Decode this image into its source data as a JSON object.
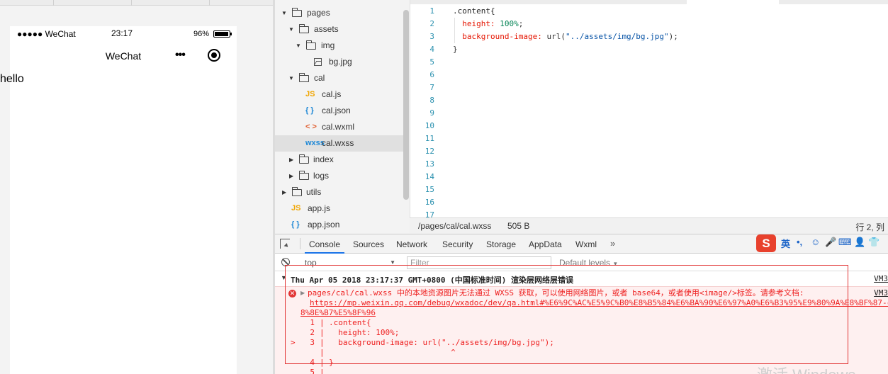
{
  "simulator": {
    "status_signal": "●●●●● WeChat",
    "status_time": "23:17",
    "status_battery": "96%",
    "nav_title": "WeChat",
    "nav_more": "•••",
    "content_text": "hello"
  },
  "tree": {
    "items": [
      {
        "label": "pages",
        "type": "folder",
        "expanded": true
      },
      {
        "label": "assets",
        "type": "folder",
        "expanded": true
      },
      {
        "label": "img",
        "type": "folder",
        "expanded": true
      },
      {
        "label": "bg.jpg",
        "type": "image"
      },
      {
        "label": "cal",
        "type": "folder",
        "expanded": true
      },
      {
        "label": "cal.js",
        "type": "js",
        "icon": "JS"
      },
      {
        "label": "cal.json",
        "type": "json",
        "icon": "{ }"
      },
      {
        "label": "cal.wxml",
        "type": "wxml",
        "icon": "< >"
      },
      {
        "label": "cal.wxss",
        "type": "wxss",
        "icon": "wxss",
        "selected": true
      },
      {
        "label": "index",
        "type": "folder",
        "expanded": false
      },
      {
        "label": "logs",
        "type": "folder",
        "expanded": false
      },
      {
        "label": "utils",
        "type": "folder",
        "expanded": false
      },
      {
        "label": "app.js",
        "type": "js",
        "icon": "JS"
      },
      {
        "label": "app.json",
        "type": "json",
        "icon": "{ }"
      }
    ]
  },
  "editor": {
    "line_numbers": [
      "1",
      "2",
      "3",
      "4",
      "5",
      "6",
      "7",
      "8",
      "9",
      "10",
      "11",
      "12",
      "13",
      "14",
      "15",
      "16",
      "17"
    ],
    "code": {
      "l1_selector": ".content{",
      "l2_prop": "height:",
      "l2_val": "100%",
      "l3_prop": "background-image:",
      "l3_fn": "url(",
      "l3_str": "\"../assets/img/bg.jpg\"",
      "l3_end": ");",
      "l4": "}"
    },
    "status_path": "/pages/cal/cal.wxss",
    "status_size": "505 B",
    "status_pos": "行 2, 列"
  },
  "devtools": {
    "tabs": [
      "Console",
      "Sources",
      "Network",
      "Security",
      "Storage",
      "AppData",
      "Wxml"
    ],
    "more": "»",
    "context": "top",
    "filter_placeholder": "Filter",
    "levels": "Default levels",
    "ime": {
      "logo": "S",
      "lang": "英",
      "punct": "•,",
      "emoji": "☺",
      "mic": "🎤",
      "kbd": "⌨",
      "user": "👤",
      "shirt": "👕"
    },
    "group_title": "Thu Apr 05 2018 23:17:37 GMT+0800 (中国标准时间) 渲染层网络层错误",
    "group_src": "VM3",
    "error": {
      "msg1": "pages/cal/cal.wxss 中的本地资源图片无法通过 WXSS 获取，可以使用网络图片，或者 base64，或者使用<image/>标签。请参考文档:",
      "link1": "https://mp.weixin.qq.com/debug/wxadoc/dev/qa.html#%E6%9C%AC%E5%9C%B0%E8%B5%84%E6%BA%90%E6%97%A0%E6%B3%95%E9%80%9A%E8%BF%87-c",
      "link2": "8%8E%B7%E5%8F%96",
      "src": "VM3",
      "frame": [
        {
          "n": "1",
          "code": ".content{",
          "arrow": ""
        },
        {
          "n": "2",
          "code": "  height: 100%;",
          "arrow": ""
        },
        {
          "n": "3",
          "code": "  background-image: url(\"../assets/img/bg.jpg\");",
          "arrow": ">"
        },
        {
          "n": "",
          "code": "                          ^",
          "arrow": ""
        },
        {
          "n": "4",
          "code": "}",
          "arrow": ""
        },
        {
          "n": "5",
          "code": "",
          "arrow": ""
        }
      ]
    }
  },
  "watermark": "激活 Windows"
}
